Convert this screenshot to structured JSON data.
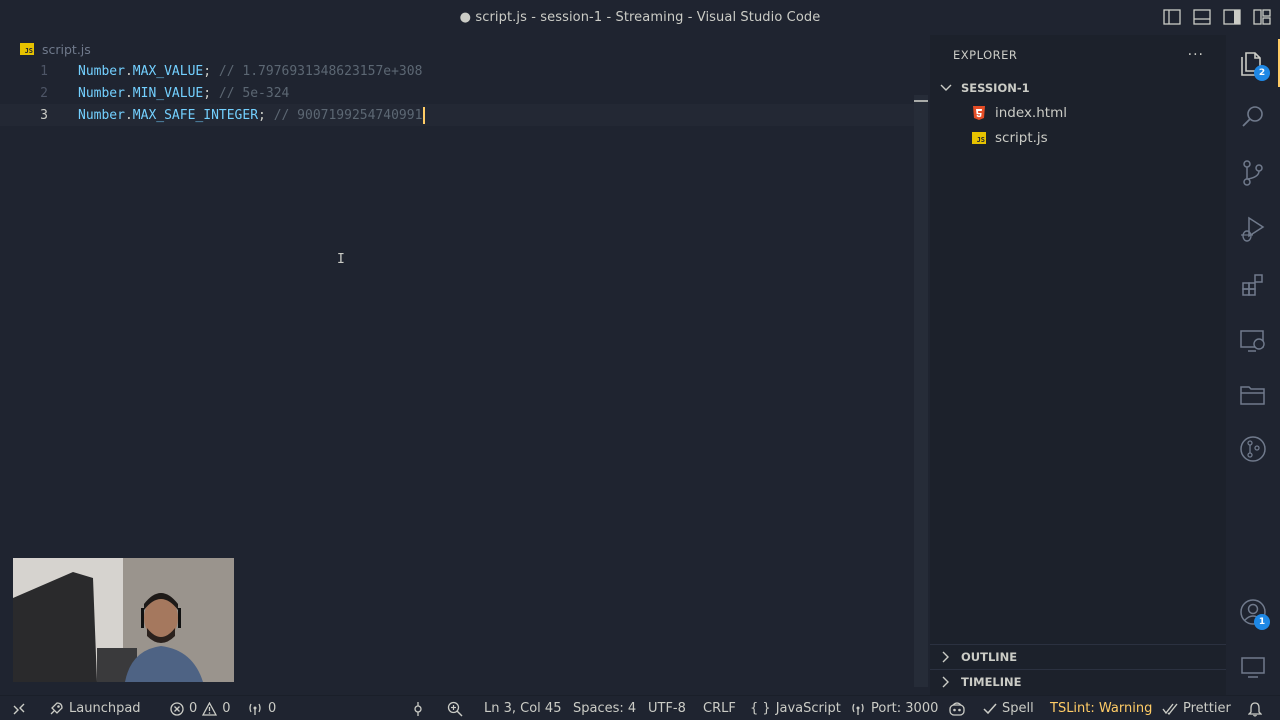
{
  "window": {
    "title": "● script.js - session-1 - Streaming - Visual Studio Code"
  },
  "editor": {
    "breadcrumb": {
      "file_icon": "JS",
      "file": "script.js"
    },
    "lines": [
      {
        "num": "1",
        "ident": "Number",
        "dot": ".",
        "prop": "MAX_VALUE",
        "semi": ";",
        "comment": "// 1.7976931348623157e+308"
      },
      {
        "num": "2",
        "ident": "Number",
        "dot": ".",
        "prop": "MIN_VALUE",
        "semi": ";",
        "comment": "// 5e-324"
      },
      {
        "num": "3",
        "ident": "Number",
        "dot": ".",
        "prop": "MAX_SAFE_INTEGER",
        "semi": ";",
        "comment": "// 9007199254740991"
      }
    ],
    "active_line": 3
  },
  "explorer": {
    "header": "EXPLORER",
    "more": "···",
    "folder": "SESSION-1",
    "files": [
      {
        "name": "index.html",
        "icon": "html-file-icon"
      },
      {
        "name": "script.js",
        "icon": "js-file-icon"
      }
    ],
    "outline": "OUTLINE",
    "timeline": "TIMELINE"
  },
  "activity_bar": {
    "explorer_badge": "2",
    "accounts_badge": "1"
  },
  "status_bar": {
    "launchpad": "Launchpad",
    "errors": "0",
    "warnings": "0",
    "ports": "0",
    "position": "Ln 3, Col 45",
    "spaces": "Spaces: 4",
    "encoding": "UTF-8",
    "eol": "CRLF",
    "language": "JavaScript",
    "port": "Port: 3000",
    "spell": "Spell",
    "tslint": "TSLint: Warning",
    "prettier": "Prettier"
  },
  "colors": {
    "background": "#1f2430",
    "identifier": "#73d0ff",
    "comment": "#5c6773",
    "cursor": "#ffcc66",
    "warning": "#ffcc66",
    "badge": "#1e88e5"
  }
}
